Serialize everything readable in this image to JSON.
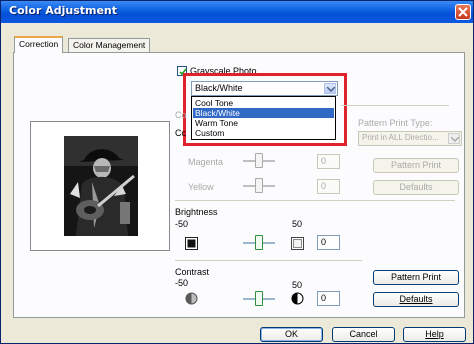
{
  "window": {
    "title": "Color Adjustment"
  },
  "tabs": [
    {
      "label": "Correction"
    },
    {
      "label": "Color Management"
    }
  ],
  "grayscale": {
    "label": "Grayscale Photo",
    "checked": true
  },
  "mode_select": {
    "value": "Black/White",
    "options": [
      "Cool Tone",
      "Black/White",
      "Warm Tone",
      "Custom"
    ],
    "selected_index": 1
  },
  "hidden_labels": {
    "color_adjust_prefix": "Co",
    "left_prefix": "Cc"
  },
  "color_rows": [
    {
      "label": "Magenta",
      "value": "0"
    },
    {
      "label": "Yellow",
      "value": "0"
    }
  ],
  "pattern": {
    "type_label": "Pattern Print Type:",
    "type_value": "Print in ALL Directio...",
    "pattern_print_label": "Pattern Print",
    "defaults_label": "Defaults"
  },
  "brightness": {
    "label": "Brightness",
    "min": "-50",
    "max": "50",
    "value": "0"
  },
  "contrast": {
    "label": "Contrast",
    "min": "-50",
    "max": "50",
    "value": "0"
  },
  "buttons": {
    "pattern_print": "Pattern Print",
    "defaults": "Defaults",
    "ok": "OK",
    "cancel": "Cancel",
    "help": "Help"
  },
  "colors": {
    "accent": "#316ac5",
    "highlight": "#e0222a",
    "title_bar": "#0a5fe0"
  }
}
